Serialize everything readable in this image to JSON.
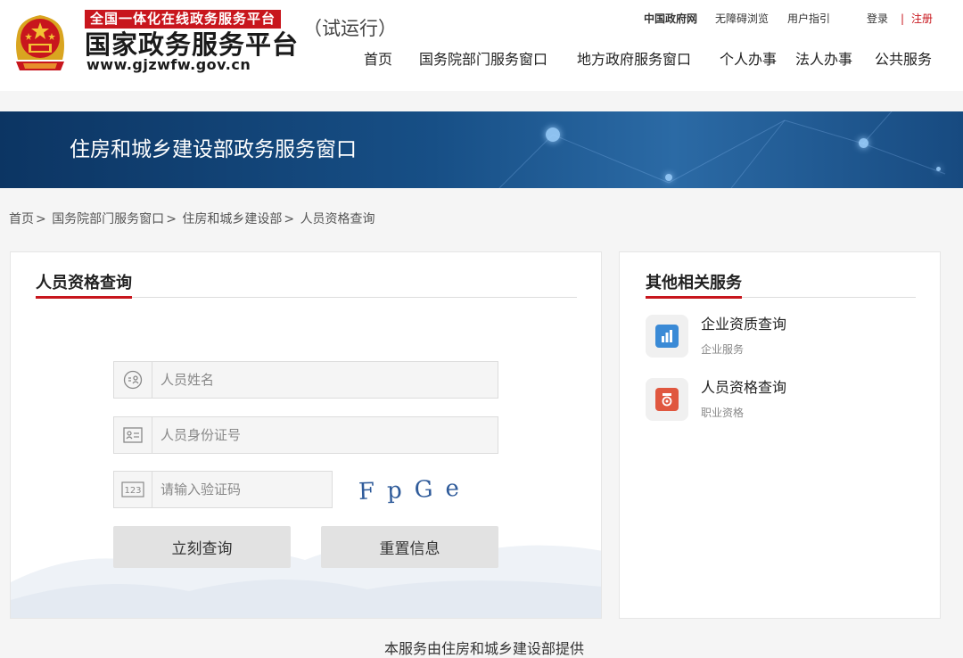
{
  "header": {
    "logo_tag": "全国一体化在线政务服务平台",
    "logo_main": "国家政务服务平台",
    "logo_url": "www.gjzwfw.gov.cn",
    "trial": "（试运行）",
    "toplinks": {
      "gov": "中国政府网",
      "accessible": "无障碍浏览",
      "guide": "用户指引",
      "login": "登录",
      "sep": "|",
      "register": "注册"
    },
    "nav": [
      "首页",
      "国务院部门服务窗口",
      "地方政府服务窗口",
      "个人办事",
      "法人办事",
      "公共服务"
    ]
  },
  "banner": {
    "title": "住房和城乡建设部政务服务窗口"
  },
  "breadcrumb": [
    "首页",
    "国务院部门服务窗口",
    "住房和城乡建设部",
    "人员资格查询"
  ],
  "breadcrumb_sep": ">",
  "main": {
    "title": "人员资格查询",
    "name_placeholder": "人员姓名",
    "id_placeholder": "人员身份证号",
    "code_placeholder": "请输入验证码",
    "captcha_text": "FpGe",
    "query_button": "立刻查询",
    "reset_button": "重置信息"
  },
  "side": {
    "title": "其他相关服务",
    "services": [
      {
        "name": "企业资质查询",
        "sub": "企业服务",
        "icon": "building-chart-icon",
        "color": "#3a8ad6"
      },
      {
        "name": "人员资格查询",
        "sub": "职业资格",
        "icon": "certificate-icon",
        "color": "#e0573f"
      }
    ]
  },
  "footer": {
    "note": "本服务由住房和城乡建设部提供"
  },
  "colors": {
    "brand_red": "#c8161d",
    "banner_blue": "#174f86"
  }
}
